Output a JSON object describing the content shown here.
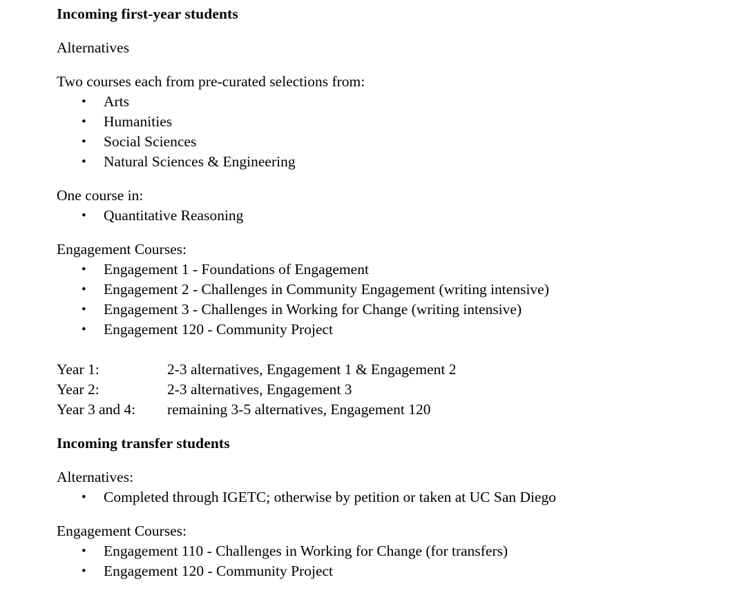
{
  "document": {
    "sections": [
      {
        "heading": "Incoming first-year students",
        "intro_label": "Alternatives",
        "groups": [
          {
            "lead": "Two courses each from pre-curated selections from:",
            "items": [
              "Arts",
              "Humanities",
              "Social Sciences",
              "Natural Sciences & Engineering"
            ]
          },
          {
            "lead": "One course in:",
            "items": [
              "Quantitative Reasoning"
            ]
          },
          {
            "lead": "Engagement Courses:",
            "items": [
              "Engagement 1 - Foundations of Engagement",
              "Engagement 2 - Challenges in Community Engagement (writing intensive)",
              "Engagement 3 - Challenges in Working for Change (writing intensive)",
              "Engagement 120 - Community Project"
            ]
          }
        ],
        "year_plan": [
          {
            "label": "Year 1:",
            "value": "2-3 alternatives, Engagement 1 & Engagement 2"
          },
          {
            "label": "Year 2:",
            "value": "2-3 alternatives, Engagement 3"
          },
          {
            "label": "Year 3 and 4:",
            "value": "remaining 3-5 alternatives, Engagement 120"
          }
        ]
      },
      {
        "heading": "Incoming transfer students",
        "groups": [
          {
            "lead": "Alternatives:",
            "items": [
              "Completed through IGETC; otherwise by petition or taken at UC San Diego"
            ]
          },
          {
            "lead": "Engagement Courses:",
            "items": [
              "Engagement 110 - Challenges in Working for Change (for transfers)",
              "Engagement 120 - Community Project"
            ]
          }
        ]
      }
    ]
  }
}
